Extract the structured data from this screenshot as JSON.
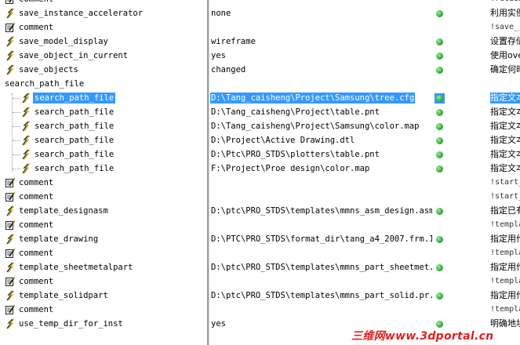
{
  "rows": [
    {
      "name": "comment",
      "icon": "comment",
      "value": "",
      "desc": "!retain",
      "desc_small": true
    },
    {
      "name": "save_instance_accelerator",
      "icon": "option",
      "value": "none",
      "status": true,
      "desc": "利用实例"
    },
    {
      "name": "comment",
      "icon": "comment",
      "value": "",
      "desc": "!save_",
      "desc_small": true
    },
    {
      "name": "save_model_display",
      "icon": "option",
      "value": "wireframe",
      "status": true,
      "desc": "设置存储"
    },
    {
      "name": "save_object_in_current",
      "icon": "option",
      "value": "yes",
      "status": true,
      "desc": "使用ove"
    },
    {
      "name": "save_objects",
      "icon": "option",
      "value": "changed",
      "status": true,
      "desc": "确定何时"
    },
    {
      "name": "search_path_file",
      "icon": "none",
      "value": "",
      "desc": ""
    },
    {
      "name": "search_path_file",
      "icon": "option",
      "value": "D:\\Tang_caisheng\\Project\\Samsung\\tree.cfg",
      "status": true,
      "desc": "指定文本",
      "selected": true,
      "indent": true
    },
    {
      "name": "search_path_file",
      "icon": "option",
      "value": "D:\\Tang_caisheng\\Project\\table.pnt",
      "status": true,
      "desc": "指定文本",
      "indent": true
    },
    {
      "name": "search_path_file",
      "icon": "option",
      "value": "D:\\Tang_caisheng\\Project\\Samsung\\color.map",
      "status": true,
      "desc": "指定文本",
      "indent": true
    },
    {
      "name": "search_path_file",
      "icon": "option",
      "value": "D:\\Project\\Active Drawing.dtl",
      "status": true,
      "desc": "指定文本",
      "indent": true
    },
    {
      "name": "search_path_file",
      "icon": "option",
      "value": "D:\\Ptc\\PRO_STDS\\plotters\\table.pnt",
      "status": true,
      "desc": "指定文本",
      "indent": true
    },
    {
      "name": "search_path_file",
      "icon": "option",
      "value": "F:\\Project\\Proe design\\color.map",
      "status": true,
      "desc": "指定文本",
      "indent": true
    },
    {
      "name": "comment",
      "icon": "comment",
      "value": "",
      "desc": "!start_",
      "desc_small": true
    },
    {
      "name": "comment",
      "icon": "comment",
      "value": "",
      "desc": "!start_",
      "desc_small": true
    },
    {
      "name": "template_designasm",
      "icon": "option",
      "value": "D:\\ptc\\PRO_STDS\\templates\\mmns_asm_design.asm.5",
      "status": true,
      "desc": "指定已有"
    },
    {
      "name": "comment",
      "icon": "comment",
      "value": "",
      "desc": "!templa",
      "desc_small": true
    },
    {
      "name": "template_drawing",
      "icon": "option",
      "value": "D:\\PTC\\PRO_STDS\\format_dir\\tang_a4_2007.frm.1",
      "status": true,
      "desc": "指定用作"
    },
    {
      "name": "comment",
      "icon": "comment",
      "value": "",
      "desc": "!templa",
      "desc_small": true
    },
    {
      "name": "template_sheetmetalpart",
      "icon": "option",
      "value": "D:\\ptc\\PRO_STDS\\templates\\mmns_part_sheetmet...",
      "status": true,
      "desc": "指定用作"
    },
    {
      "name": "comment",
      "icon": "comment",
      "value": "",
      "desc": "!templa",
      "desc_small": true
    },
    {
      "name": "template_solidpart",
      "icon": "option",
      "value": "D:\\ptc\\PRO_STDS\\templates\\mmns_part_solid.pr...",
      "status": true,
      "desc": "指定用作"
    },
    {
      "name": "comment",
      "icon": "comment",
      "value": "",
      "desc": "!templa",
      "desc_small": true
    },
    {
      "name": "use_temp_dir_for_inst",
      "icon": "option",
      "value": "yes",
      "status": true,
      "desc": "明确地址"
    }
  ],
  "watermark": "三维网www.3dportal.cn",
  "colors": {
    "selection": "#3399ff",
    "status_green": "#3cb043",
    "watermark": "#e02020"
  }
}
